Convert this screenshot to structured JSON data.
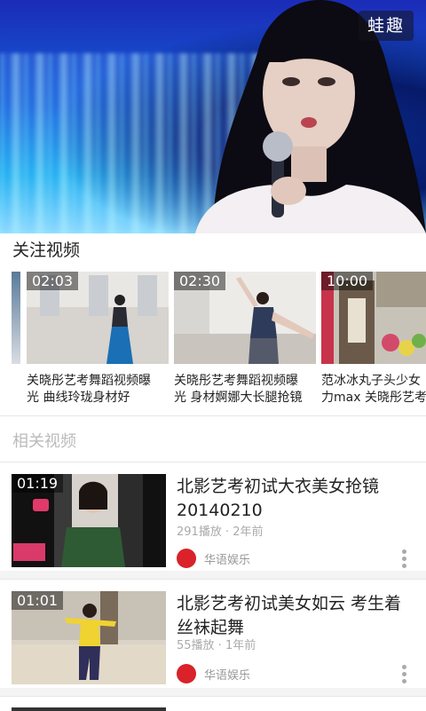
{
  "hero": {
    "badge": "蛙趣"
  },
  "follow": {
    "title": "关注视频",
    "cards": [
      {
        "duration": "02:03",
        "caption_line1": "关晓彤艺考舞蹈视频曝",
        "caption_line2": "光 曲线玲珑身材好"
      },
      {
        "duration": "02:30",
        "caption_line1": "关晓彤艺考舞蹈视频曝",
        "caption_line2": "光 身材婀娜大长腿抢镜"
      },
      {
        "duration": "10:00",
        "caption_line1": "范冰冰丸子头少女",
        "caption_line2": "力max 关晓彤艺考"
      }
    ]
  },
  "related": {
    "title": "相关视频",
    "items": [
      {
        "duration": "01:19",
        "title": "北影艺考初试大衣美女抢镜20140210",
        "meta": "291播放 · 2年前",
        "source": "华语娱乐"
      },
      {
        "duration": "01:01",
        "title": "北影艺考初试美女如云 考生着丝袜起舞",
        "meta": "55播放 · 1年前",
        "source": "华语娱乐"
      }
    ]
  },
  "colors": {
    "accent": "#d9222a",
    "meta": "#aaaaaa",
    "background": "#f4f4f4"
  },
  "icons": {
    "badge": "logo-badge",
    "more": "more-vertical-icon",
    "avatar": "source-avatar"
  }
}
